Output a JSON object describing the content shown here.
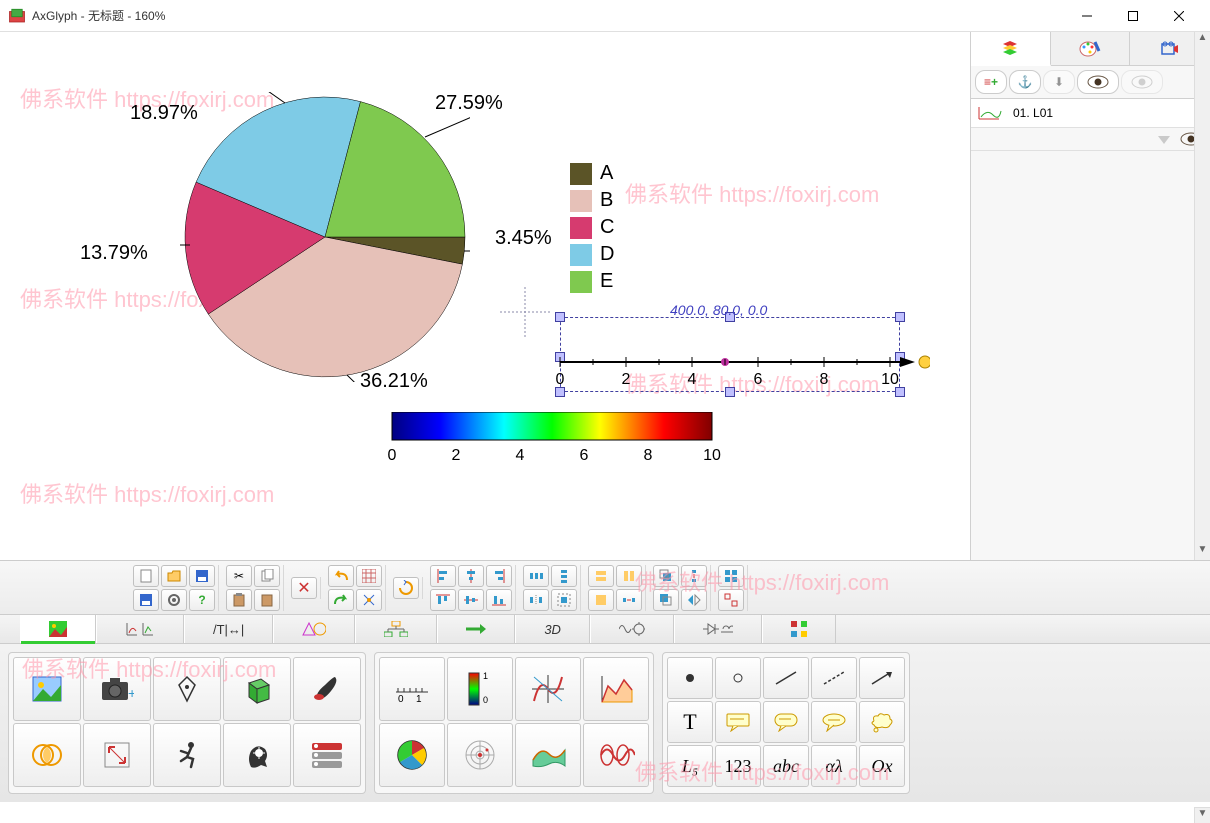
{
  "window": {
    "title": "AxGlyph - 无标题 - 160%"
  },
  "watermark": "佛系软件 https://foxirj.com",
  "chart_data": {
    "type": "pie",
    "title": "",
    "series": [
      {
        "name": "A",
        "value": 3.45,
        "color": "#5b5427",
        "label": "3.45%"
      },
      {
        "name": "B",
        "value": 36.21,
        "color": "#e6c1b8",
        "label": "36.21%"
      },
      {
        "name": "C",
        "value": 13.79,
        "color": "#d63b6f",
        "label": "13.79%"
      },
      {
        "name": "D",
        "value": 18.97,
        "color": "#7ecbe6",
        "label": "18.97%"
      },
      {
        "name": "E",
        "value": 27.59,
        "color": "#7fc94f",
        "label": "27.59%"
      }
    ],
    "legend_position": "right"
  },
  "numberline": {
    "ticks": [
      "0",
      "2",
      "4",
      "6",
      "8",
      "10"
    ],
    "selection_readout": "400.0, 80.0, 0.0"
  },
  "colorbar": {
    "ticks": [
      "0",
      "2",
      "4",
      "6",
      "8",
      "10"
    ]
  },
  "right_panel": {
    "layer_name": "01. L01"
  },
  "cat_tabs": {
    "t3d": "3D"
  },
  "palette_c": {
    "T": "T",
    "L5": "L₅",
    "n123": "123",
    "abc": "abc",
    "alpha": "αλ",
    "Ox": "Ox"
  }
}
